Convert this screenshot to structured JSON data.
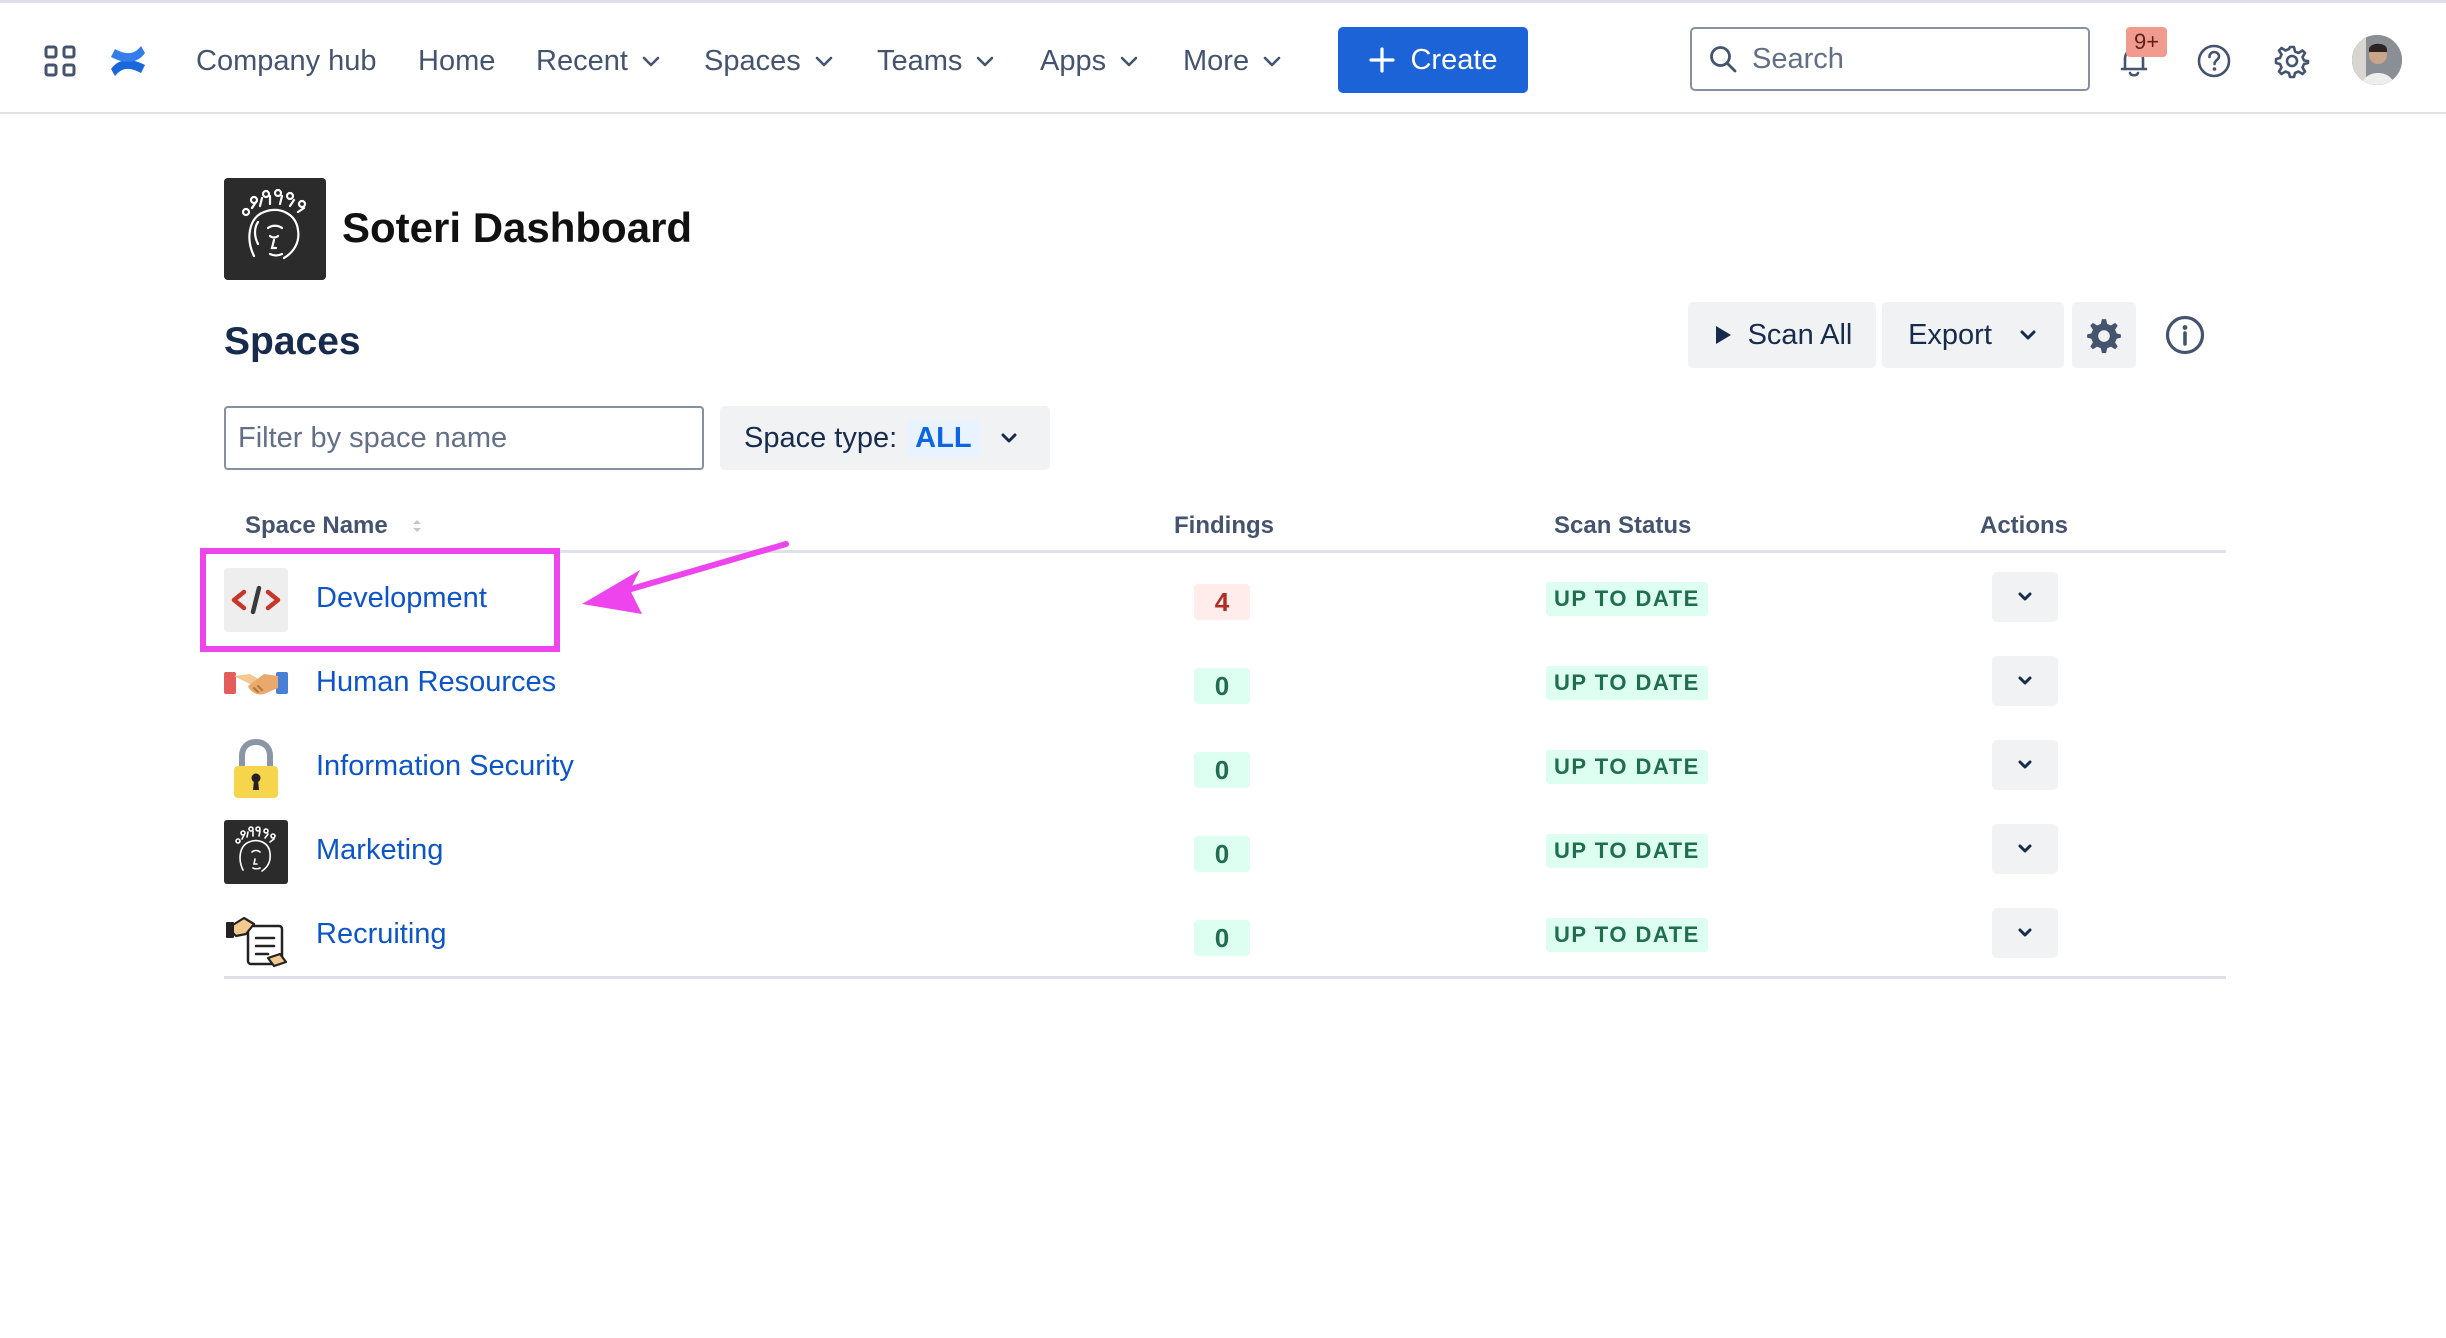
{
  "nav": {
    "items": [
      {
        "label": "Company hub",
        "dropdown": false
      },
      {
        "label": "Home",
        "dropdown": false
      },
      {
        "label": "Recent",
        "dropdown": true
      },
      {
        "label": "Spaces",
        "dropdown": true
      },
      {
        "label": "Teams",
        "dropdown": true
      },
      {
        "label": "Apps",
        "dropdown": true
      },
      {
        "label": "More",
        "dropdown": true
      }
    ],
    "create_label": "Create",
    "search_placeholder": "Search",
    "notification_badge": "9+",
    "accent_color": "#1d63d8"
  },
  "header": {
    "title": "Soteri Dashboard"
  },
  "spaces": {
    "section_title": "Spaces",
    "scan_all_label": "Scan All",
    "export_label": "Export",
    "filter_placeholder": "Filter by space name",
    "space_type_label": "Space type:",
    "space_type_value": "ALL",
    "columns": {
      "name": "Space Name",
      "findings": "Findings",
      "status": "Scan Status",
      "actions": "Actions"
    },
    "rows": [
      {
        "name": "Development",
        "icon": "code-icon",
        "findings": "4",
        "status": "UP TO DATE"
      },
      {
        "name": "Human Resources",
        "icon": "handshake-icon",
        "findings": "0",
        "status": "UP TO DATE"
      },
      {
        "name": "Information Security",
        "icon": "lock-icon",
        "findings": "0",
        "status": "UP TO DATE"
      },
      {
        "name": "Marketing",
        "icon": "soteri-logo-icon",
        "findings": "0",
        "status": "UP TO DATE"
      },
      {
        "name": "Recruiting",
        "icon": "recruiting-icon",
        "findings": "0",
        "status": "UP TO DATE"
      }
    ]
  },
  "annotation": {
    "highlight_color": "#ee44ee"
  }
}
